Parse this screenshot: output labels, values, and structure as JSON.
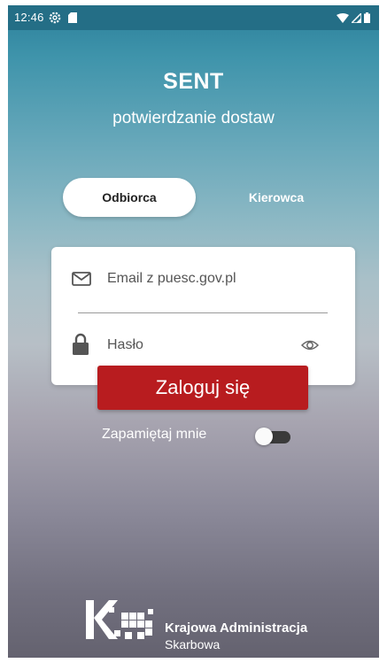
{
  "status_bar": {
    "time": "12:46",
    "icons": [
      "gear-icon",
      "sd-card-icon",
      "wifi-icon",
      "signal-icon",
      "battery-icon"
    ]
  },
  "header": {
    "title": "SENT",
    "subtitle": "potwierdzanie dostaw"
  },
  "tabs": {
    "active_label": "Odbiorca",
    "inactive_label": "Kierowca"
  },
  "form": {
    "email_placeholder": "Email z puesc.gov.pl",
    "password_placeholder": "Hasło",
    "login_label": "Zaloguj się",
    "remember_label": "Zapamiętaj mnie",
    "remember_enabled": false
  },
  "footer": {
    "org_name": "Krajowa Administracja",
    "org_sub": "Skarbowa"
  },
  "colors": {
    "login_button": "#b81c1f",
    "status_bar": "#246e86"
  }
}
